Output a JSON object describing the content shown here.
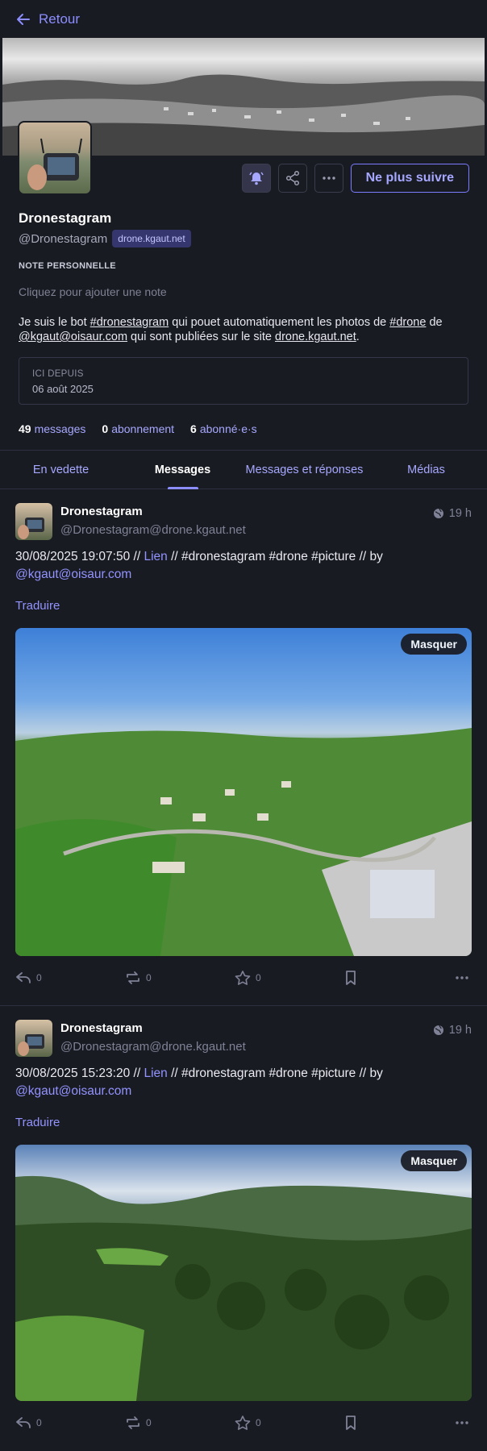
{
  "nav": {
    "back_label": "Retour"
  },
  "profile": {
    "name": "Dronestagram",
    "handle": "@Dronestagram",
    "domain": "drone.kgaut.net",
    "follow_label": "Ne plus suivre",
    "note_label": "NOTE PERSONNELLE",
    "note_placeholder": "Cliquez pour ajouter une note",
    "bio": {
      "p1": "Je suis le bot ",
      "tag1": "#dronestagram",
      "p2": " qui pouet automatiquement les photos de ",
      "tag2": "#drone",
      "p3": " de ",
      "mention": "@kgaut@oisaur.com",
      "p4": " qui sont publiées sur le site ",
      "site": "drone.kgaut.net",
      "p5": "."
    },
    "since_label": "ICI DEPUIS",
    "since_date": "06 août 2025",
    "counts": {
      "posts": "49",
      "posts_label": "messages",
      "following": "0",
      "following_label": "abonnement",
      "followers": "6",
      "followers_label": "abonné·e·s"
    }
  },
  "tabs": [
    "En vedette",
    "Messages",
    "Messages et réponses",
    "Médias"
  ],
  "posts": [
    {
      "author": "Dronestagram",
      "acct": "@Dronestagram@drone.kgaut.net",
      "time": "19 h",
      "text_a": "30/08/2025 19:07:50 // ",
      "link": "Lien",
      "text_b": " // #dronestagram #drone #picture // by",
      "mention": "@kgaut@oisaur.com",
      "translate": "Traduire",
      "hide": "Masquer",
      "replies": "0",
      "boosts": "0",
      "favs": "0"
    },
    {
      "author": "Dronestagram",
      "acct": "@Dronestagram@drone.kgaut.net",
      "time": "19 h",
      "text_a": "30/08/2025 15:23:20 // ",
      "link": "Lien",
      "text_b": " // #dronestagram #drone #picture // by",
      "mention": "@kgaut@oisaur.com",
      "translate": "Traduire",
      "hide": "Masquer",
      "replies": "0",
      "boosts": "0",
      "favs": "0"
    }
  ]
}
